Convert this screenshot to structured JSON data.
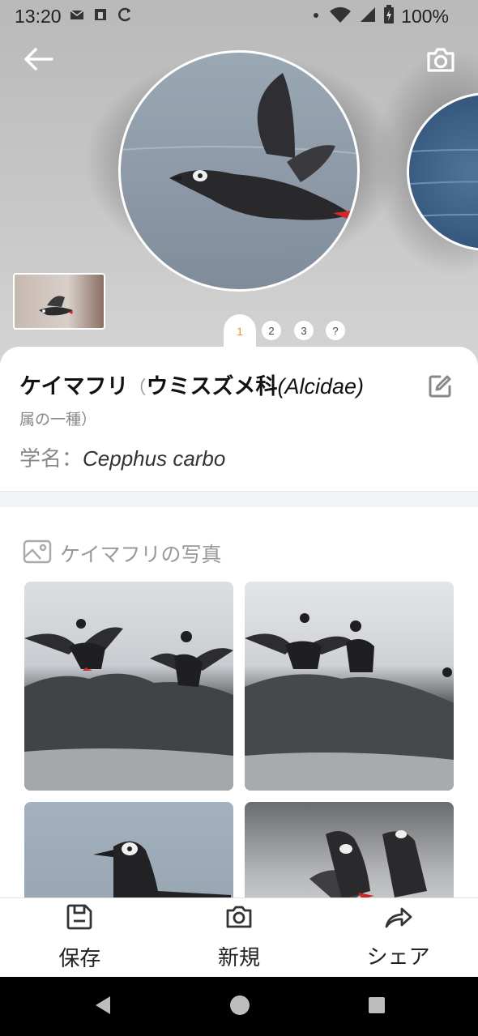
{
  "status_bar": {
    "time": "13:20",
    "battery_percent": "100%"
  },
  "hero": {
    "pages": [
      "1",
      "2",
      "3",
      "?"
    ],
    "active_page": "1"
  },
  "species": {
    "name": "ケイマフリ",
    "paren_open": "（",
    "family": "ウミスズメ科",
    "family_latin": "(Alcidae)",
    "genus_line": "属の一種）",
    "scientific_label": "学名：",
    "scientific_name": "Cepphus carbo"
  },
  "photos": {
    "title": "ケイマフリの写真"
  },
  "toolbar": {
    "save_label": "保存",
    "new_label": "新規",
    "share_label": "シェア"
  },
  "icons": {
    "back": "arrow-left-icon",
    "camera": "camera-icon",
    "edit": "edit-icon",
    "gallery": "image-icon",
    "save": "floppy-disk-icon",
    "new": "camera-icon",
    "share": "share-arrow-icon"
  },
  "colors": {
    "active_page": "#e39a2a",
    "divider": "#f1f5f8"
  }
}
